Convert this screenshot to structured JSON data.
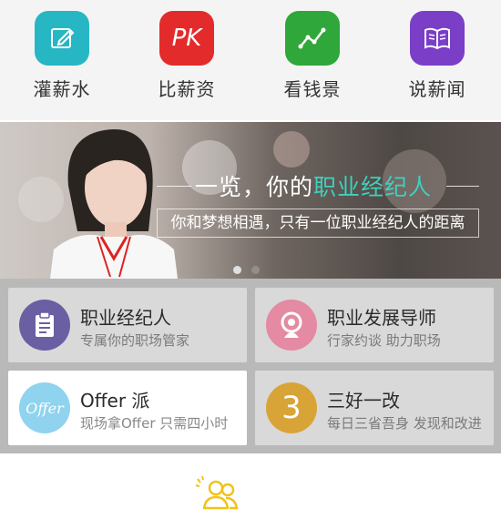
{
  "nav": {
    "items": [
      {
        "label": "灌薪水",
        "icon": "edit-icon",
        "color": "#27b6c4"
      },
      {
        "label": "比薪资",
        "icon": "pk-icon",
        "icon_text": "PK",
        "color": "#e32b2b"
      },
      {
        "label": "看钱景",
        "icon": "trend-chart-icon",
        "color": "#2fa73a"
      },
      {
        "label": "说薪闻",
        "icon": "book-icon",
        "color": "#7a3ec7"
      }
    ]
  },
  "banner": {
    "headline_prefix": "一览，你的",
    "headline_highlight": "职业经纪人",
    "subline": "你和梦想相遇，只有一位职业经纪人的距离",
    "active_slide": 1,
    "slide_count": 2
  },
  "cards": [
    {
      "title": "职业经纪人",
      "subtitle": "专属你的职场管家",
      "icon": "clipboard-icon",
      "color": "#6a5fa3"
    },
    {
      "title": "职业发展导师",
      "subtitle": "行家约谈 助力职场",
      "icon": "mentor-icon",
      "color": "#e48aa3"
    },
    {
      "title": "Offer 派",
      "subtitle": "现场拿Offer 只需四小时",
      "icon": "offer-icon",
      "icon_text": "Offer",
      "color": "#8fd3ee"
    },
    {
      "title": "三好一改",
      "subtitle": "每日三省吾身 发现和改进",
      "icon": "number-three-icon",
      "icon_text": "3",
      "color": "#d9a437"
    }
  ],
  "bottom": {
    "icon": "community-icon",
    "color": "#f2c318"
  }
}
